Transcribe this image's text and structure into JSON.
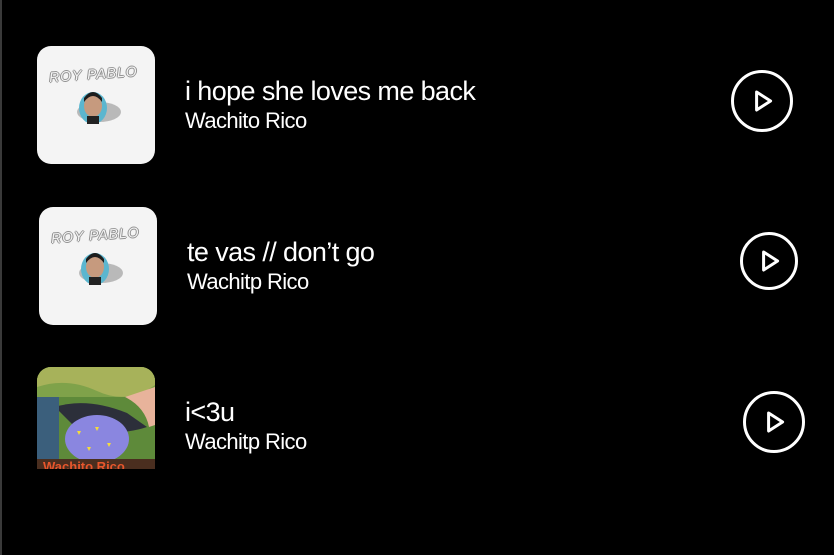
{
  "playlist": {
    "tracks": [
      {
        "title": "i hope she loves me back",
        "artist": "Wachito Rico",
        "album_art_text": "ROY PABLO",
        "album_art_style": "light"
      },
      {
        "title": "te vas // don’t go",
        "artist": "Wachitp Rico",
        "album_art_text": "ROY PABLO",
        "album_art_style": "light"
      },
      {
        "title": "i<3u",
        "artist": "Wachitp Rico",
        "album_art_text": "",
        "album_art_style": "photo"
      }
    ]
  },
  "colors": {
    "background": "#000000",
    "text": "#ffffff",
    "icon": "#ffffff"
  },
  "icons": {
    "play": "play-circle-icon"
  }
}
